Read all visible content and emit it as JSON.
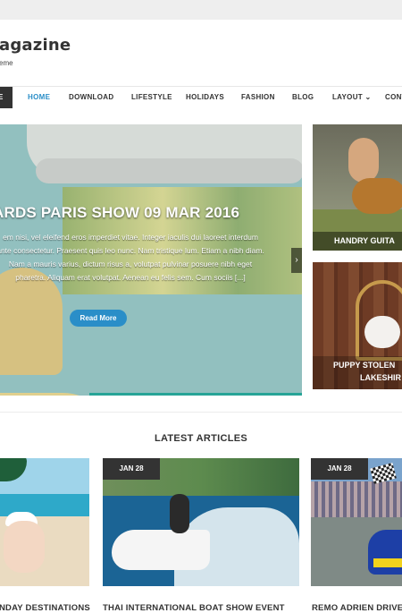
{
  "site": {
    "title": "agazine",
    "tagline": "eme"
  },
  "nav": {
    "home_block": "E",
    "items": [
      "HOME",
      "DOWNLOAD",
      "LIFESTYLE",
      "HOLIDAYS",
      "FASHION",
      "BLOG",
      "LAYOUT",
      "CONT"
    ],
    "layout_chevron": "⌄"
  },
  "slider": {
    "title": "ARDS PARIS SHOW 09 MAR 2016",
    "excerpt": "em nisi, vel eleifend eros imperdiet vitae. Integer iaculis dui laoreet interdum ante consectetur. Praesent quis leo nunc. Nam tristique lum. Etiam a nibh diam. Nam a mauris varius, dictum risus a, volutpat pulvinar posuere nibh eget pharetra. Aliquam erat volutpat. Aenean eu felis sem. Cum sociis [...]",
    "button": "Read More",
    "arrow": "‹"
  },
  "side_cards": [
    {
      "label": "HANDRY GUITA"
    },
    {
      "label_line1": "PUPPY STOLEN",
      "label_line2": "LAKESHIR"
    }
  ],
  "latest": {
    "heading": "LATEST ARTICLES",
    "articles": [
      {
        "title": "NDAY DESTINATIONS",
        "date": ""
      },
      {
        "title": "THAI INTERNATIONAL BOAT SHOW EVENT",
        "date": "JAN 28"
      },
      {
        "title": "REMO ADRIEN DRIVE",
        "date": "JAN 28"
      }
    ]
  }
}
